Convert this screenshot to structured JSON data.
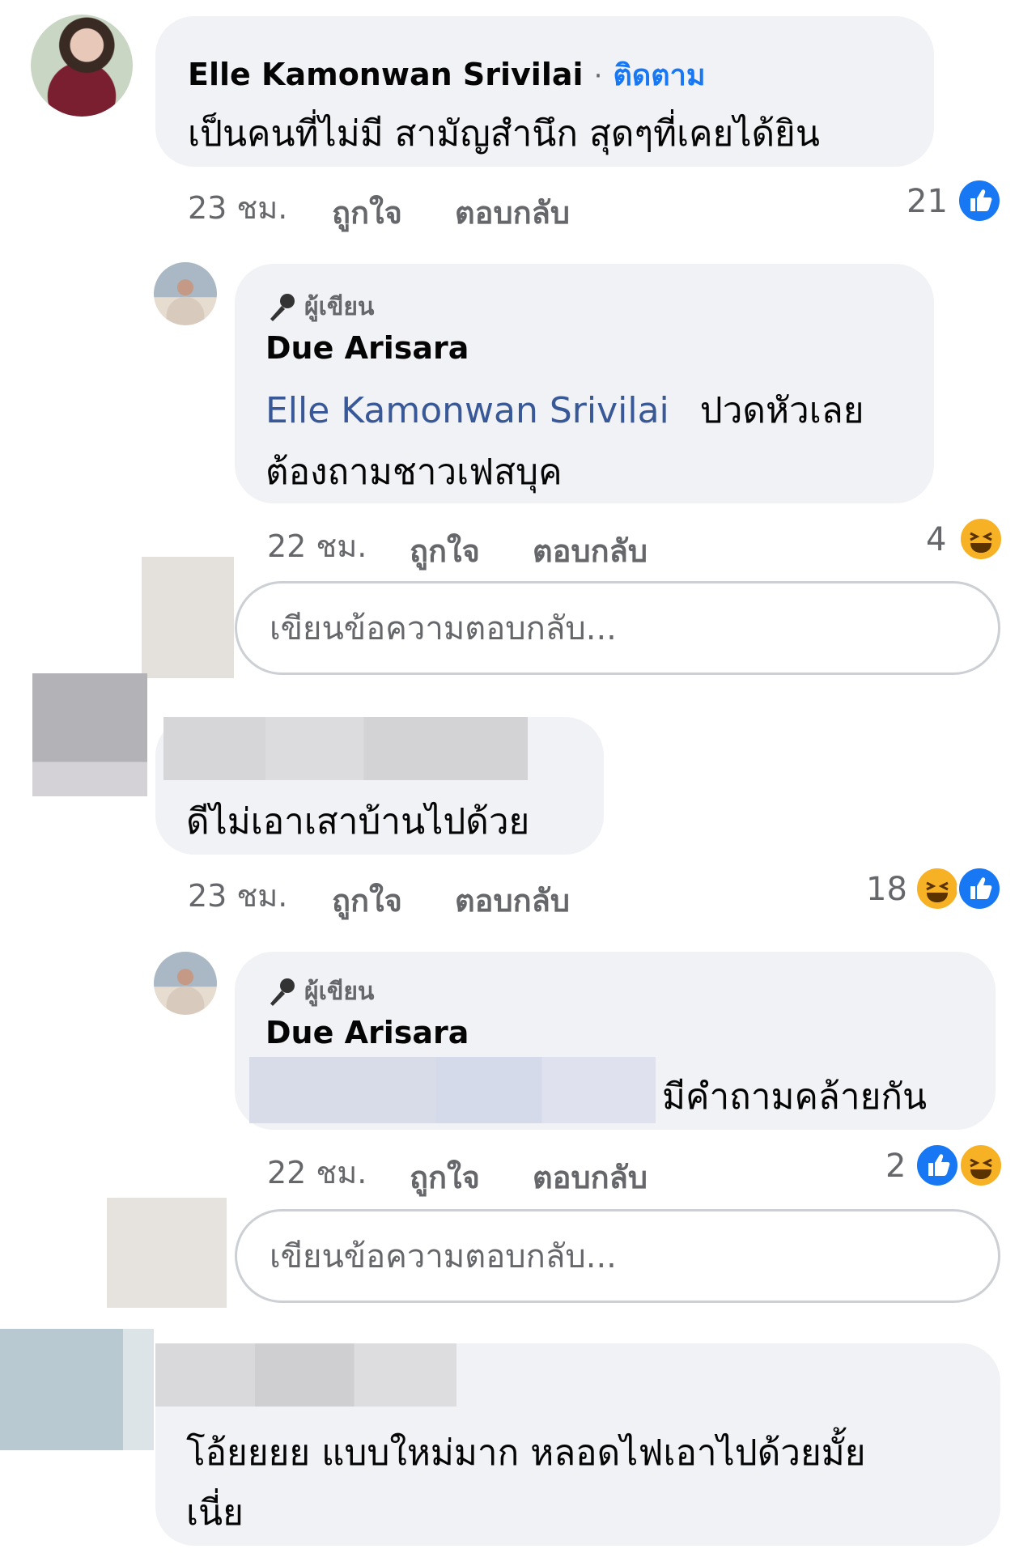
{
  "comment1": {
    "author": "Elle Kamonwan Srivilai",
    "follow_sep": "·",
    "follow_label": "ติดตาม",
    "text": "เป็นคนที่ไม่มี สามัญสำนึก สุดๆที่เคยได้ยิน",
    "time": "23 ชม.",
    "like_label": "ถูกใจ",
    "reply_label": "ตอบกลับ",
    "reaction_count": "21",
    "reactions": [
      "like-icon"
    ]
  },
  "reply1": {
    "badge": "ผู้เขียน",
    "author": "Due Arisara",
    "mention": "Elle Kamonwan Srivilai",
    "text_line1": "ปวดหัวเลย",
    "text_line2": "ต้องถามชาวเฟสบุค",
    "time": "22 ชม.",
    "like_label": "ถูกใจ",
    "reply_label": "ตอบกลับ",
    "reaction_count": "4",
    "reactions": [
      "haha-icon"
    ]
  },
  "reply_box1": {
    "placeholder": "เขียนข้อความตอบกลับ..."
  },
  "comment2": {
    "text": "ดีไม่เอาเสาบ้านไปด้วย",
    "time": "23 ชม.",
    "like_label": "ถูกใจ",
    "reply_label": "ตอบกลับ",
    "reaction_count": "18",
    "reactions": [
      "haha-icon",
      "like-icon"
    ]
  },
  "reply2": {
    "badge": "ผู้เขียน",
    "author": "Due Arisara",
    "text": "มีคำถามคล้ายกัน",
    "time": "22 ชม.",
    "like_label": "ถูกใจ",
    "reply_label": "ตอบกลับ",
    "reaction_count": "2",
    "reactions": [
      "like-icon",
      "haha-icon"
    ]
  },
  "reply_box2": {
    "placeholder": "เขียนข้อความตอบกลับ..."
  },
  "comment3": {
    "text_line1": "โอ้ยยยย แบบใหม่มาก หลอดไฟเอาไปด้วยมั้ย",
    "text_line2": "เนี่ย"
  },
  "colors": {
    "bubble": "#f0f2f5",
    "link": "#1877f2",
    "mention": "#385898",
    "muted": "#65676b"
  }
}
